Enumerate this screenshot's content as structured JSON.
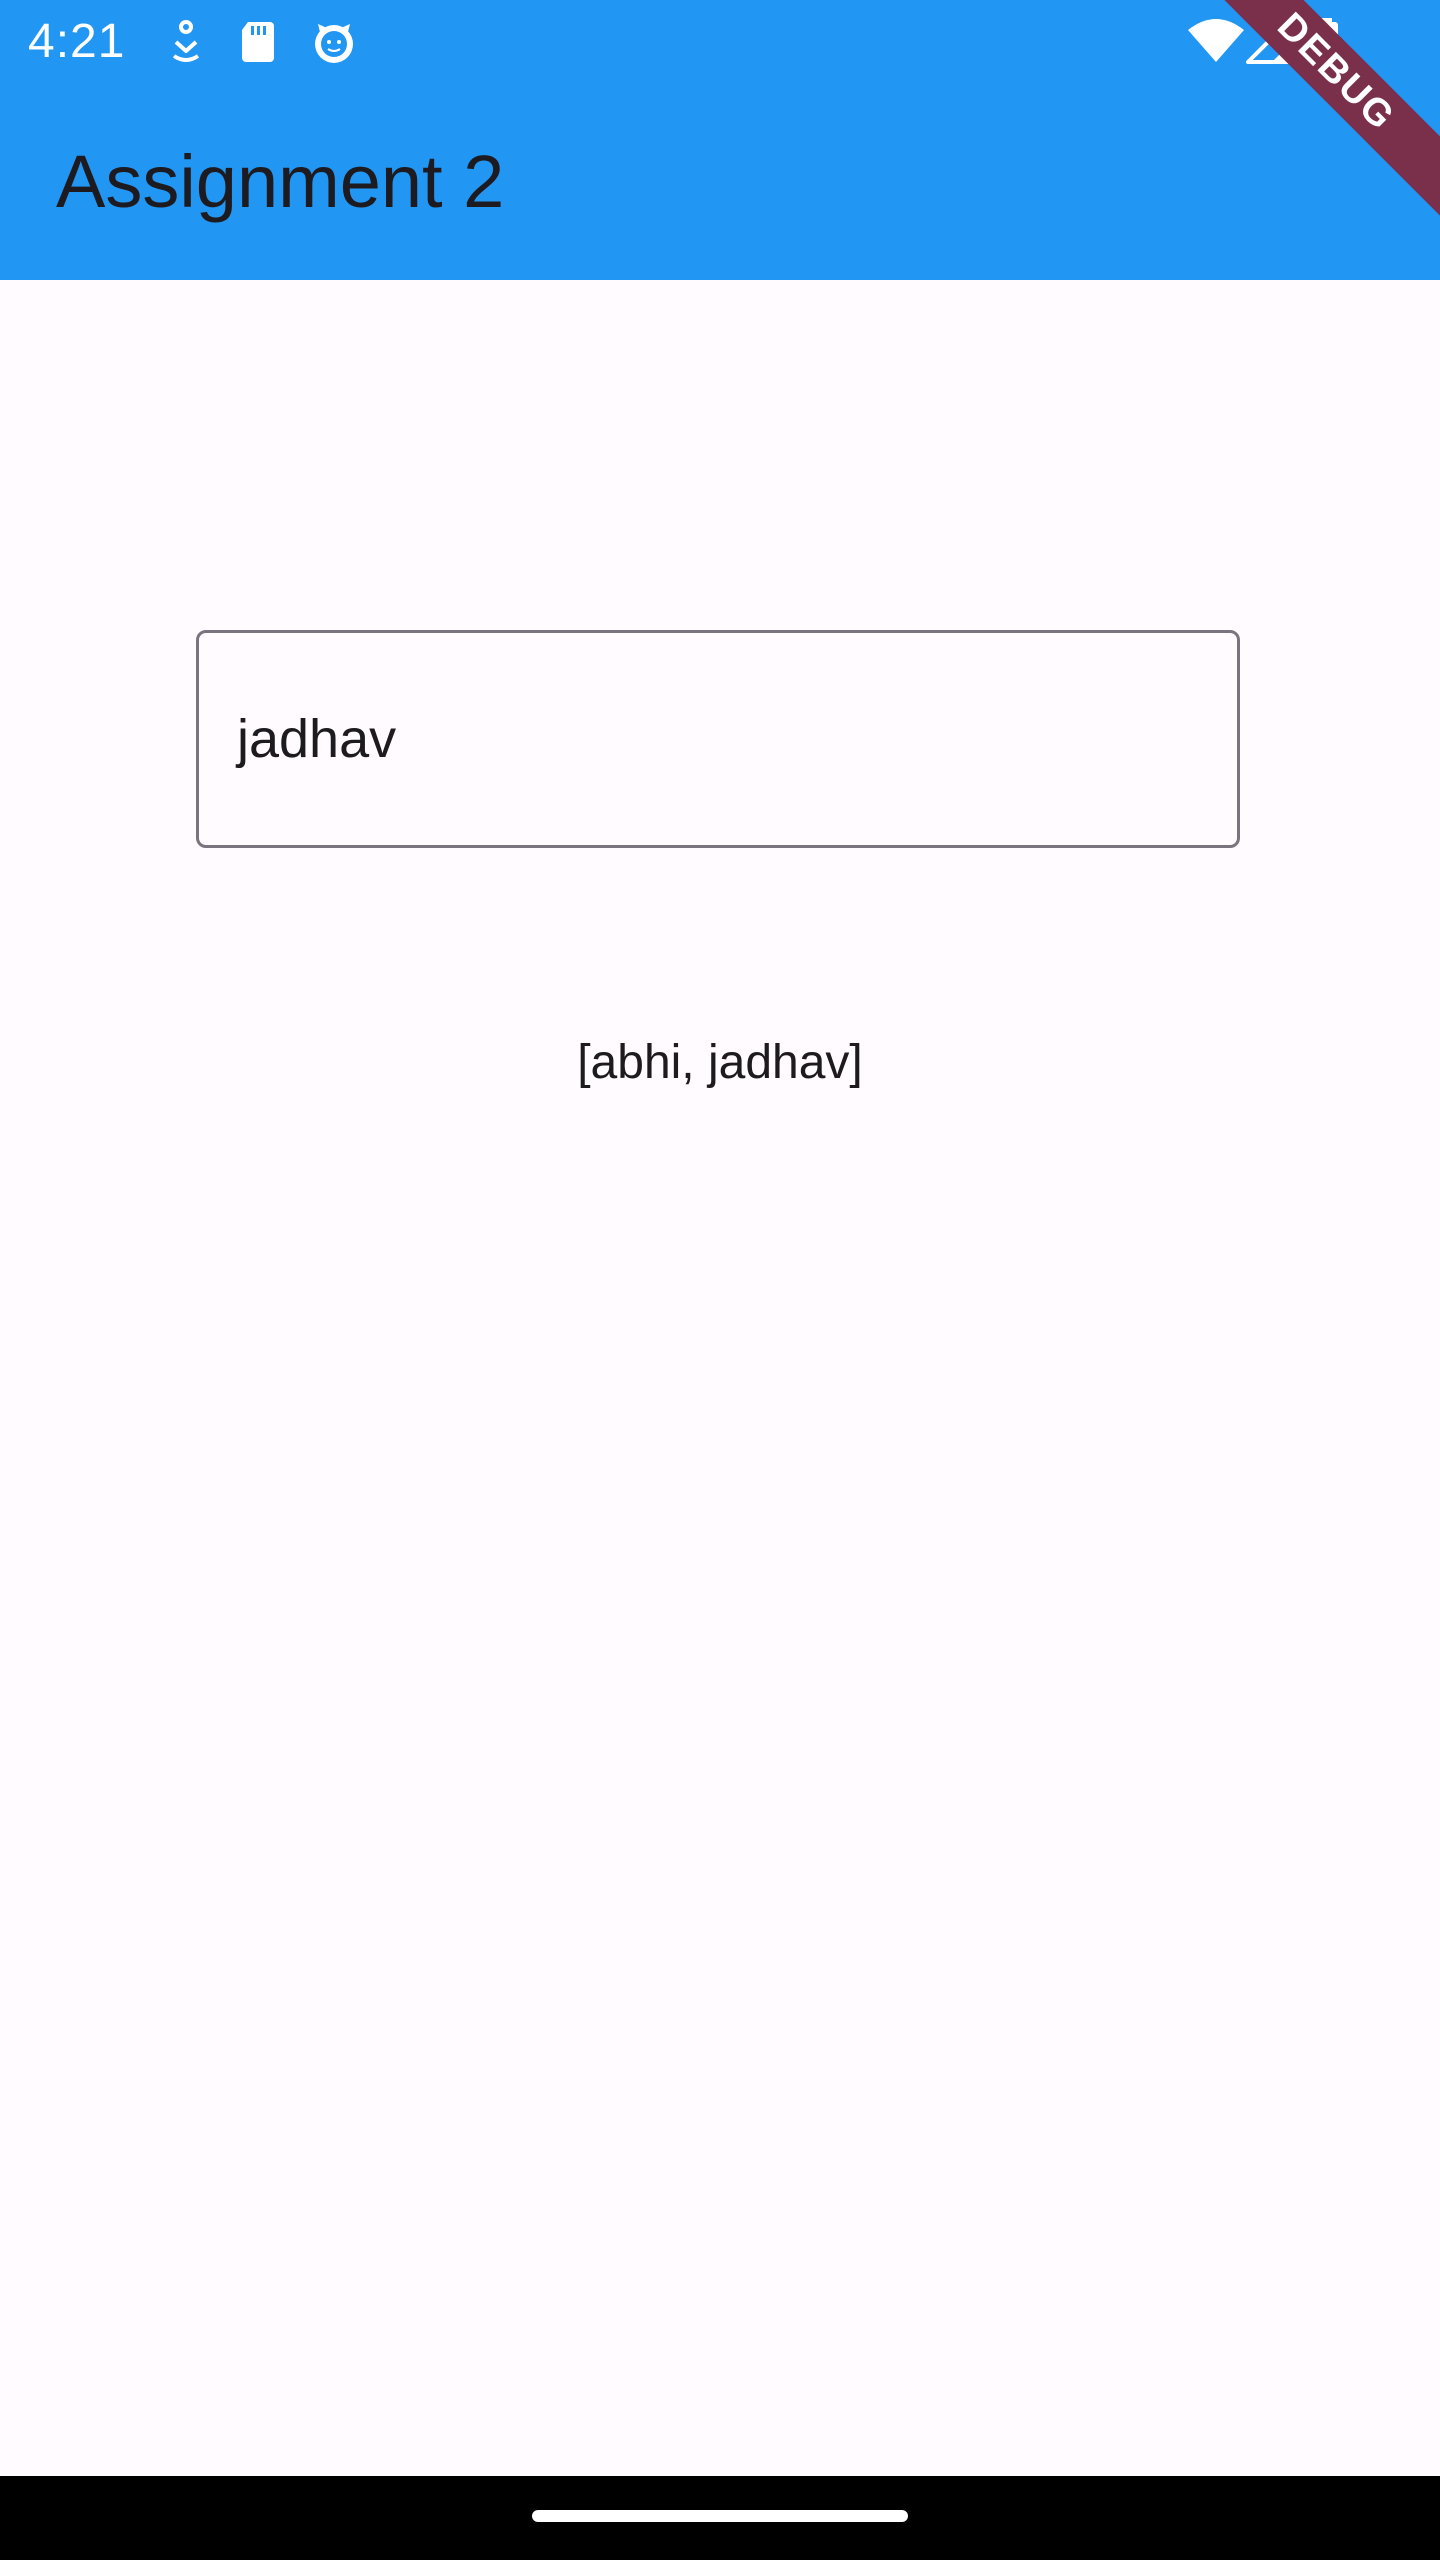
{
  "status_bar": {
    "time": "4:21",
    "icons_left": [
      "accessibility-icon",
      "sd-card-icon",
      "face-icon"
    ],
    "icons_right": [
      "wifi-icon",
      "cell-signal-icon",
      "battery-icon"
    ]
  },
  "app_bar": {
    "title": "Assignment 2",
    "debug_label": "DEBUG"
  },
  "form": {
    "input_value": "jadhav",
    "result_text": "[abhi, jadhav]"
  },
  "colors": {
    "primary": "#2196f3",
    "background": "#fffbfe",
    "text": "#1d1b20",
    "outline": "#79747e",
    "debug_banner": "#7a2f4b"
  }
}
